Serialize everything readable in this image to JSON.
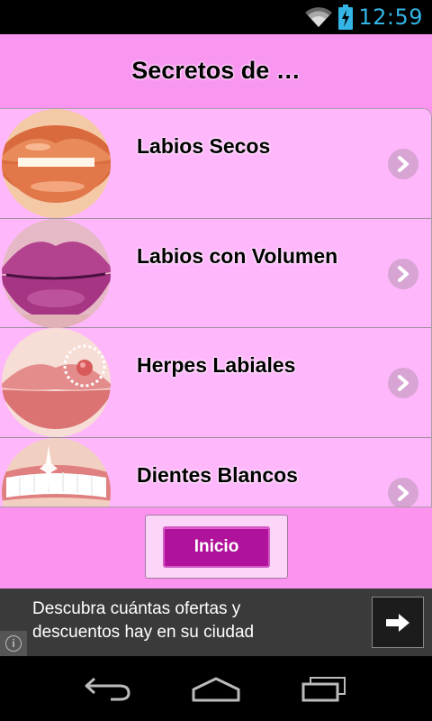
{
  "status_bar": {
    "time": "12:59",
    "icons": [
      "wifi-icon",
      "battery-charging-icon"
    ]
  },
  "header": {
    "title": "Secretos de …"
  },
  "list": {
    "items": [
      {
        "label": "Labios Secos",
        "thumb": "glossy-orange-lips"
      },
      {
        "label": "Labios con Volumen",
        "thumb": "purple-lips"
      },
      {
        "label": "Herpes Labiales",
        "thumb": "lips-with-cold-sore"
      },
      {
        "label": "Dientes Blancos",
        "thumb": "white-teeth-smile"
      }
    ],
    "chevron_icon": "chevron-right-icon"
  },
  "footer": {
    "inicio_label": "Inicio"
  },
  "ad": {
    "line1": "Descubra cuántas ofertas y",
    "line2": "descuentos hay en su ciudad",
    "info_icon": "info-icon",
    "arrow_icon": "arrow-right-icon"
  },
  "nav": {
    "buttons": [
      "back-icon",
      "home-icon",
      "recent-apps-icon"
    ]
  },
  "colors": {
    "header_bg": "#f996f0",
    "row_bg": "#ffb7fb",
    "button_bg": "#b0129b",
    "clock": "#33b5e5"
  }
}
